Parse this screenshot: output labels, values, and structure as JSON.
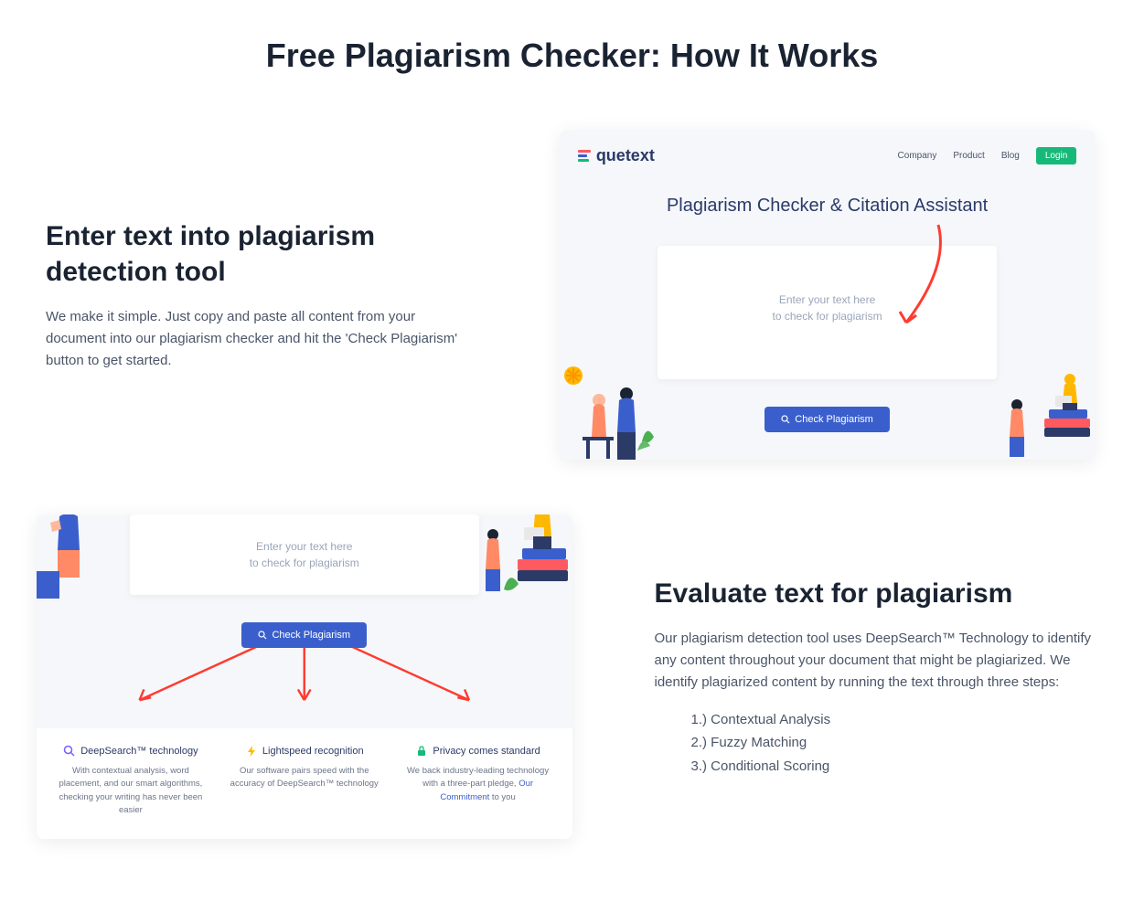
{
  "heading": "Free Plagiarism Checker: How It Works",
  "section1": {
    "title": "Enter text into plagiarism detection tool",
    "body": "We make it simple. Just copy and paste all content from your document into our plagiarism checker and hit the 'Check Plagiarism' button to get started."
  },
  "preview1": {
    "logo": "quetext",
    "nav": {
      "company": "Company",
      "product": "Product",
      "blog": "Blog",
      "login": "Login"
    },
    "hero": "Plagiarism Checker & Citation Assistant",
    "placeholder_l1": "Enter your text here",
    "placeholder_l2": "to check for plagiarism",
    "button": "Check Plagiarism"
  },
  "preview2": {
    "placeholder_l1": "Enter your text here",
    "placeholder_l2": "to check for plagiarism",
    "button": "Check Plagiarism",
    "features": [
      {
        "title": "DeepSearch™ technology",
        "desc": "With contextual analysis, word placement, and our smart algorithms, checking your writing has never been easier"
      },
      {
        "title": "Lightspeed recognition",
        "desc": "Our software pairs speed with the accuracy of DeepSearch™ technology"
      },
      {
        "title": "Privacy comes standard",
        "desc_pre": "We back industry-leading technology with a three-part pledge, ",
        "link": "Our Commitment",
        "desc_post": " to you"
      }
    ]
  },
  "section2": {
    "title": "Evaluate text for plagiarism",
    "body": "Our plagiarism detection tool uses DeepSearch™ Technology to identify any content throughout your document that might be plagiarized. We identify plagiarized content by running the text through three steps:",
    "steps": [
      "1.) Contextual Analysis",
      "2.) Fuzzy Matching",
      "3.) Conditional Scoring"
    ]
  }
}
